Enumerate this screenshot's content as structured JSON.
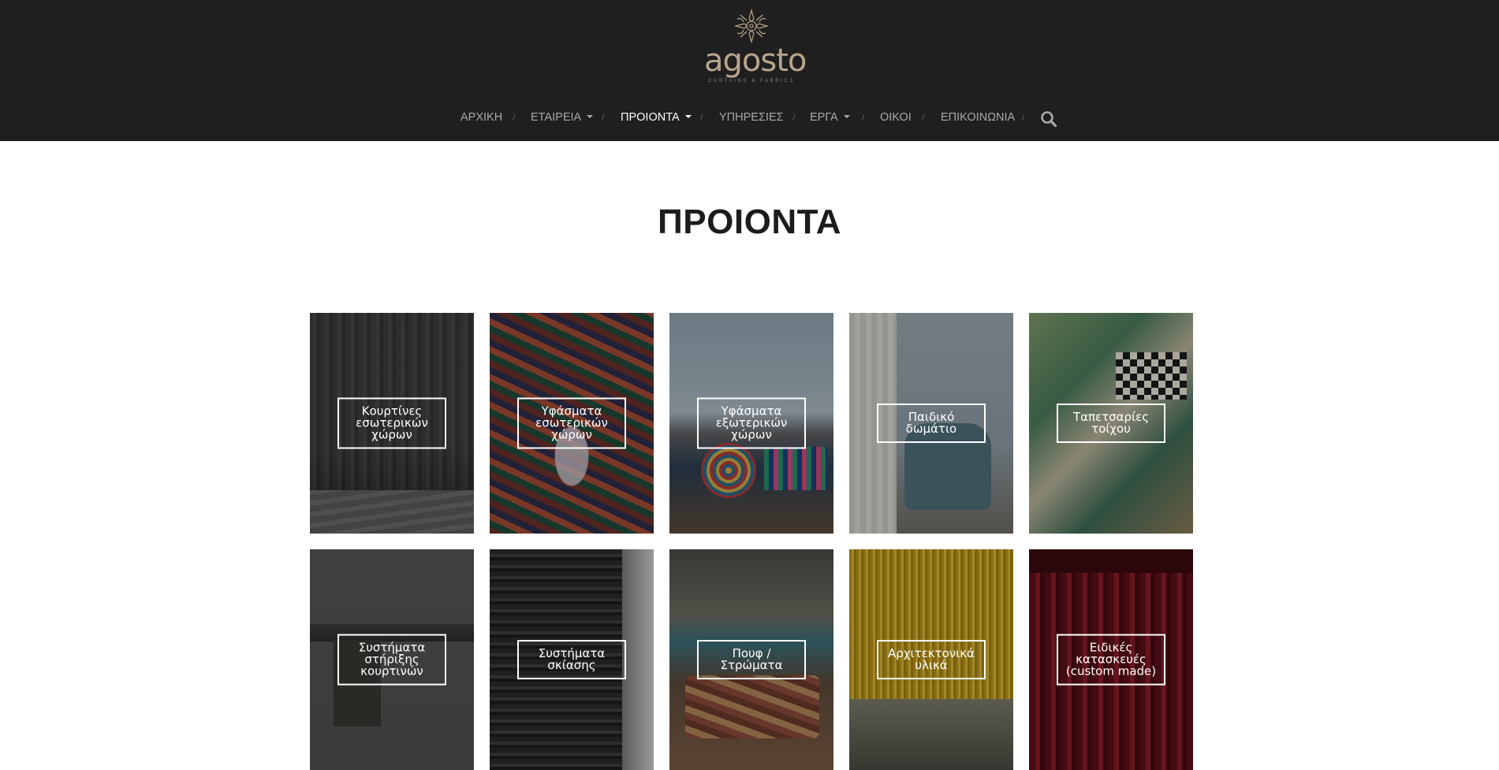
{
  "brand": {
    "name": "agosto",
    "tagline": "CURTAINS & FABRICS"
  },
  "nav": {
    "items": [
      {
        "label": "ΑΡΧΙΚΗ",
        "dropdown": false,
        "active": false
      },
      {
        "label": "ΕΤΑΙΡΕΙΑ",
        "dropdown": true,
        "active": false
      },
      {
        "label": "ΠΡΟΙΟΝΤΑ",
        "dropdown": true,
        "active": true
      },
      {
        "label": "ΥΠΗΡΕΣΙΕΣ",
        "dropdown": false,
        "active": false
      },
      {
        "label": "ΕΡΓΑ",
        "dropdown": true,
        "active": false
      },
      {
        "label": "ΟΙΚΟΙ",
        "dropdown": false,
        "active": false
      },
      {
        "label": "ΕΠΙΚΟΙΝΩΝΙΑ",
        "dropdown": false,
        "active": false
      }
    ],
    "separator": "/",
    "search_icon": "search-icon"
  },
  "page": {
    "title": "ΠΡΟΙΟΝΤΑ"
  },
  "products": [
    {
      "label": "Κουρτίνες εσωτερικών χώρων",
      "image": "sheer-curtain-photo"
    },
    {
      "label": "Υφάσματα εσωτερικών χώρων",
      "image": "patterned-fabric-photo"
    },
    {
      "label": "Υφάσματα εξωτερικών χώρων",
      "image": "outdoor-cushions-photo"
    },
    {
      "label": "Παιδικό δωμάτιο",
      "image": "kids-room-photo"
    },
    {
      "label": "Ταπετσαρίες τοίχου",
      "image": "wallpaper-photo"
    },
    {
      "label": "Συστήματα στήριξης κουρτινών",
      "image": "curtain-rod-photo"
    },
    {
      "label": "Συστήματα σκίασης",
      "image": "roller-blind-photo"
    },
    {
      "label": "Πουφ / Στρώματα",
      "image": "poolside-lounge-photo"
    },
    {
      "label": "Αρχιτεκτονικά υλικά",
      "image": "architectural-materials-photo"
    },
    {
      "label": "Ειδικές κατασκευές (custom made)",
      "image": "custom-theatre-curtain-photo"
    }
  ],
  "colors": {
    "header_bg": "#1f1f1f",
    "nav_text": "#a9a9a9",
    "nav_active": "#ffffff",
    "logo_gold": "#b7a58c",
    "title_text": "#1c1c1c"
  }
}
